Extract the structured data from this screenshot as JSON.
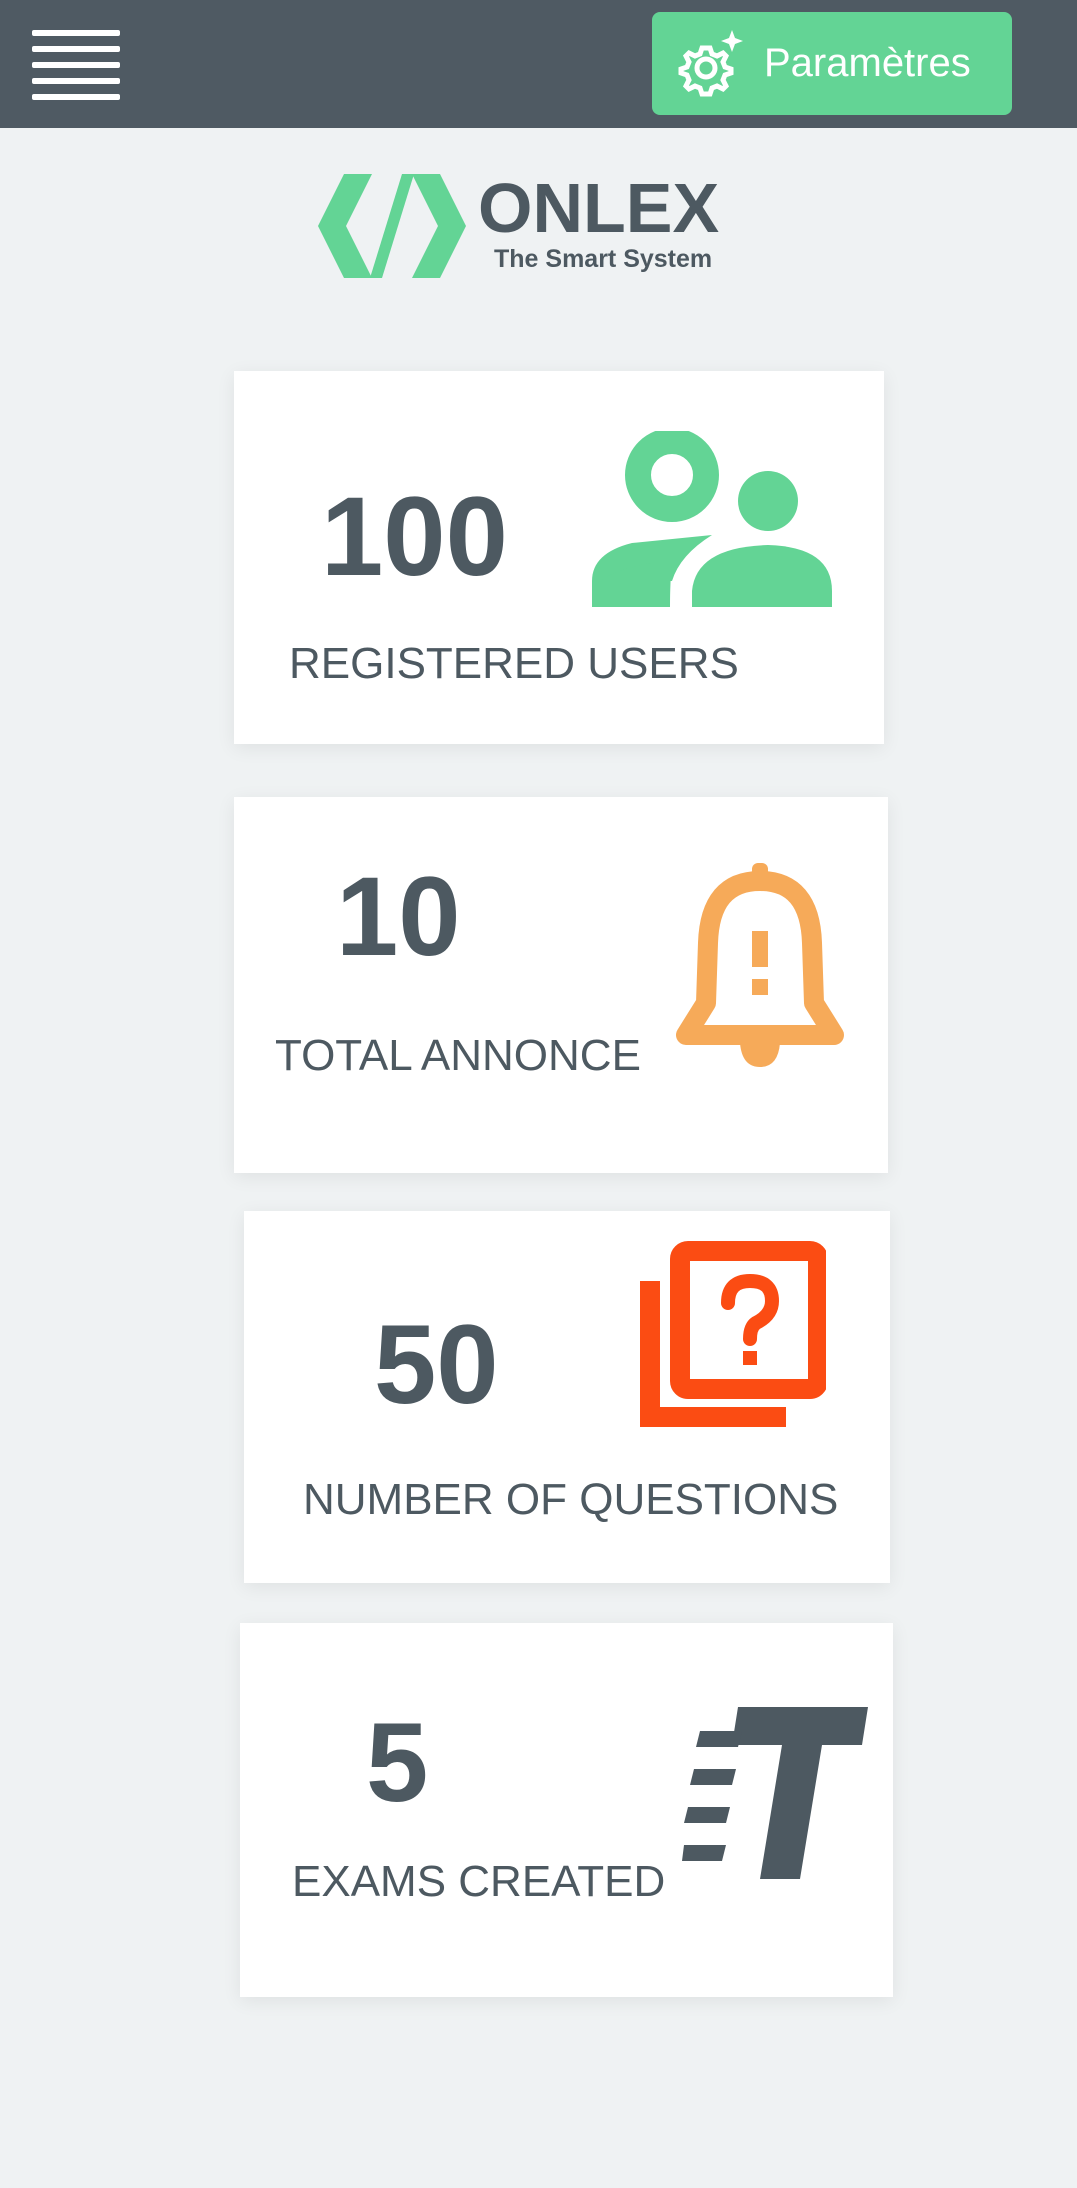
{
  "header": {
    "menu_icon": "hamburger-icon",
    "settings": {
      "label": "Paramètres",
      "icon": "gear-sparkle-icon"
    }
  },
  "logo": {
    "name": "ONLEX",
    "tagline": "The Smart System",
    "icon": "code-brackets-icon"
  },
  "stats": [
    {
      "value": "100",
      "label": "REGISTERED USERS",
      "icon": "users-icon",
      "color": "#63d495"
    },
    {
      "value": "10",
      "label": "TOTAL ANNONCE",
      "icon": "bell-alert-icon",
      "color": "#f6aa59"
    },
    {
      "value": "50",
      "label": "NUMBER OF QUESTIONS",
      "icon": "question-stack-icon",
      "color": "#fb4c13"
    },
    {
      "value": "5",
      "label": "EXAMS CREATED",
      "icon": "text-type-icon",
      "color": "#4d5961"
    }
  ],
  "colors": {
    "topbar": "#4f5a63",
    "accent": "#63d495",
    "background": "#eff2f3",
    "text": "#4d5961"
  }
}
